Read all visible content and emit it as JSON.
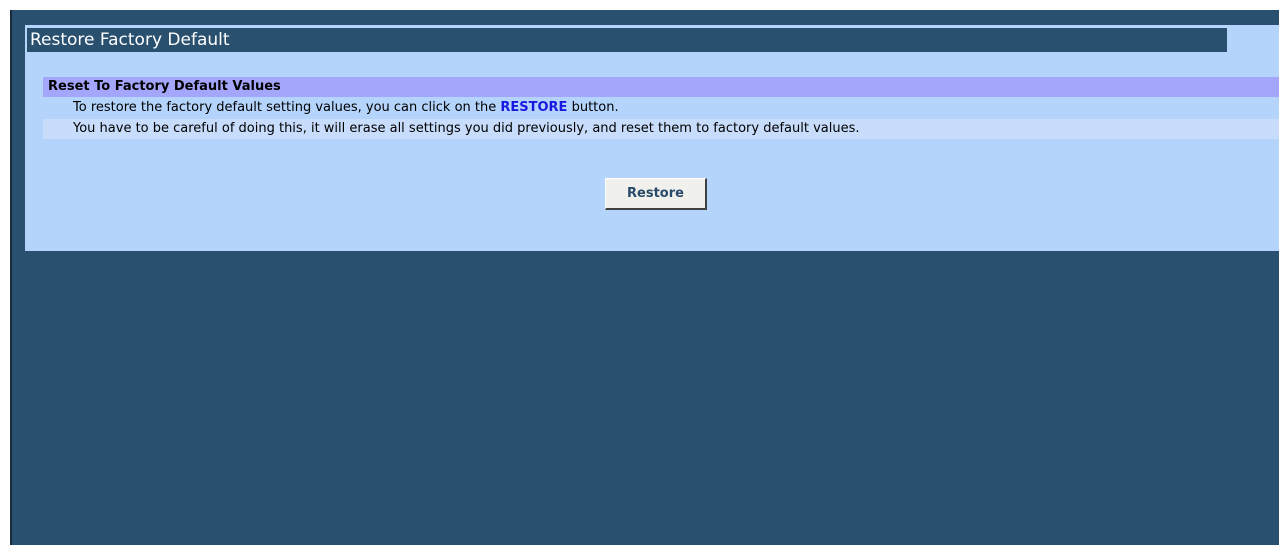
{
  "page": {
    "title": "Restore Factory Default"
  },
  "section": {
    "header": "Reset To Factory Default Values",
    "line1_prefix": "To restore the factory default setting values, you can click on the ",
    "line1_keyword": "RESTORE",
    "line1_suffix": " button.",
    "line2": "You have to be careful of doing this, it will erase all settings you did previously, and reset them to factory default values."
  },
  "buttons": {
    "restore_label": "Restore"
  },
  "colors": {
    "frame_bg": "#2a5070",
    "panel_bg": "#b4d4fc",
    "header_bg": "#a4a6fc",
    "keyword": "#1a18e0"
  }
}
